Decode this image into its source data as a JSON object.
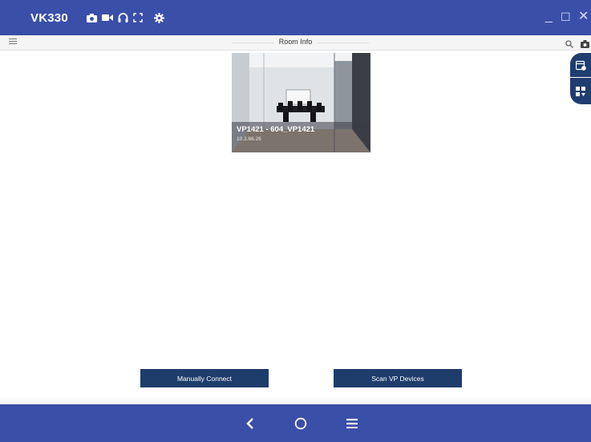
{
  "app": {
    "title": "VK330"
  },
  "window_controls": {
    "minimize": "_",
    "maximize": "☐",
    "close": "✕"
  },
  "toolbar_icons": [
    "camera-icon",
    "video-icon",
    "headset-icon",
    "fullscreen-icon",
    "gear-icon"
  ],
  "subbar": {
    "title": "Room Info"
  },
  "room": {
    "name": "VP1421 - 604_VP1421",
    "ip": "10.3.66.26"
  },
  "buttons": {
    "manual_connect": "Manually Connect",
    "scan": "Scan VP Devices"
  },
  "colors": {
    "header": "#3a4fa8",
    "button": "#1e3d6b",
    "side_button": "#1f3d6e"
  }
}
